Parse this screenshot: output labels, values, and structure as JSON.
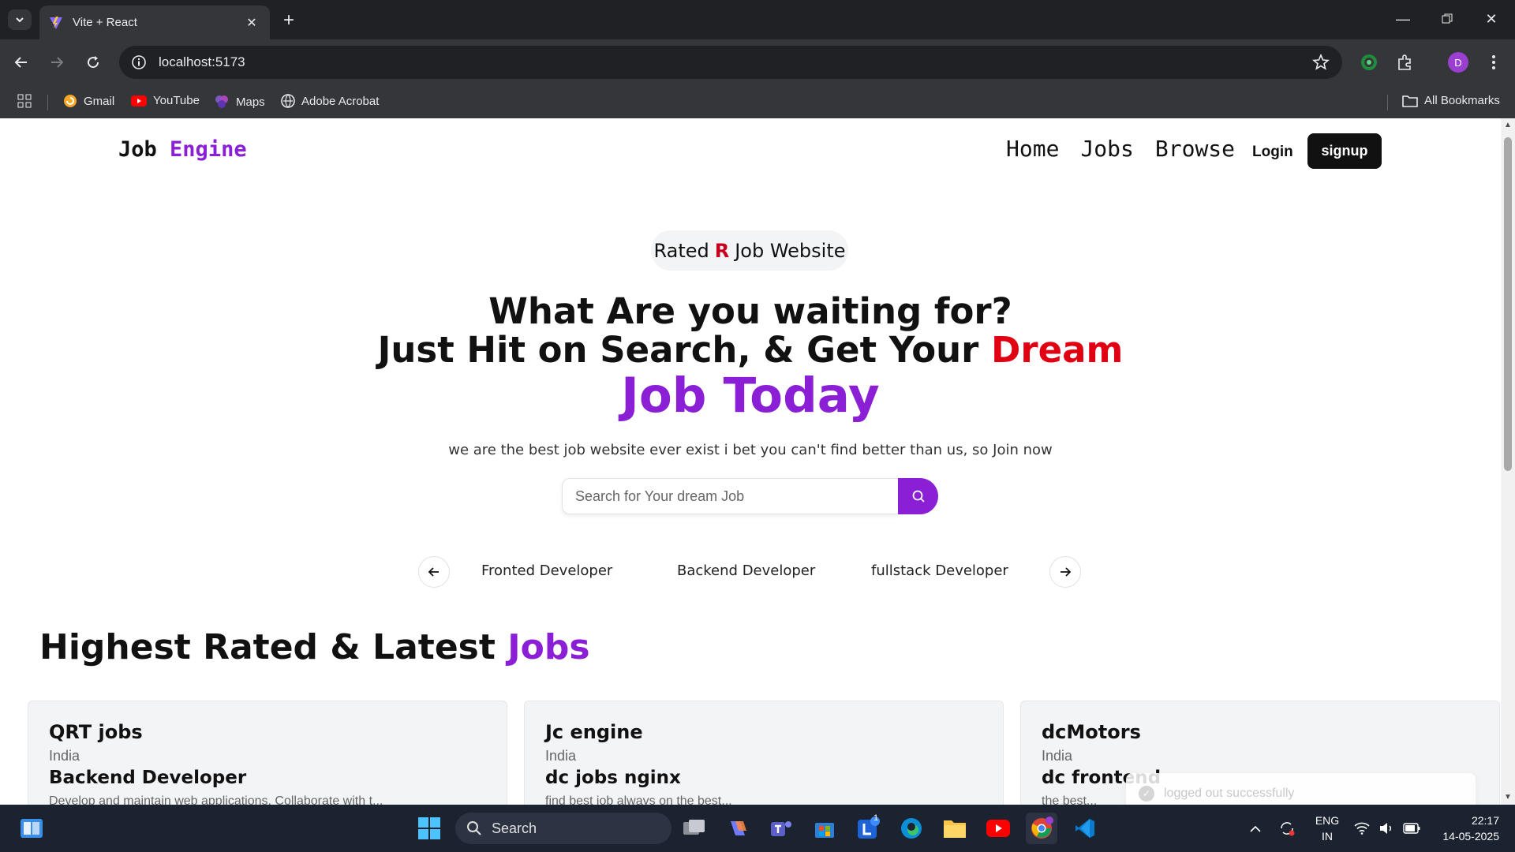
{
  "browser": {
    "tab_title": "Vite + React",
    "url": "localhost:5173",
    "profile_initial": "D",
    "bookmarks": [
      {
        "label": "Gmail",
        "icon": "gmail-icon"
      },
      {
        "label": "YouTube",
        "icon": "youtube-icon"
      },
      {
        "label": "Maps",
        "icon": "maps-icon"
      },
      {
        "label": "Adobe Acrobat",
        "icon": "acrobat-icon"
      }
    ],
    "all_bookmarks": "All Bookmarks"
  },
  "site": {
    "brand_first": "Job",
    "brand_second": "Engine",
    "nav": [
      "Home",
      "Jobs",
      "Browse"
    ],
    "login": "Login",
    "signup": "signup"
  },
  "hero": {
    "badge_pre": "Rated",
    "badge_r": "R",
    "badge_post": "Job Website",
    "line1": "What Are you waiting for?",
    "line2": "Just Hit on Search, & Get Your",
    "line2_highlight": "Dream",
    "line3": "Job Today",
    "tagline": "we are the best job website ever exist i bet you can't find better than us, so Join now",
    "search_placeholder": "Search for Your dream Job"
  },
  "categories": [
    "Fronted Developer",
    "Backend Developer",
    "fullstack Developer"
  ],
  "jobs_section": {
    "title": "Highest Rated & Latest",
    "title_accent": "Jobs"
  },
  "jobs": [
    {
      "company": "QRT jobs",
      "location": "India",
      "role": "Backend Developer",
      "desc": "Develop and maintain web applications. Collaborate with t..."
    },
    {
      "company": "Jc engine",
      "location": "India",
      "role": "dc jobs nginx",
      "desc": "find best job always on the best..."
    },
    {
      "company": "dcMotors",
      "location": "India",
      "role": "dc frontend",
      "desc": "the best..."
    }
  ],
  "toast": "logged out successfully",
  "taskbar": {
    "search_label": "Search",
    "lang_line1": "ENG",
    "lang_line2": "IN",
    "time": "22:17",
    "date": "14-05-2025",
    "teams_badge": "1"
  },
  "colors": {
    "accent_purple": "#8a1fd6",
    "dream_red": "#e00012",
    "rated_red": "#c8001e"
  }
}
